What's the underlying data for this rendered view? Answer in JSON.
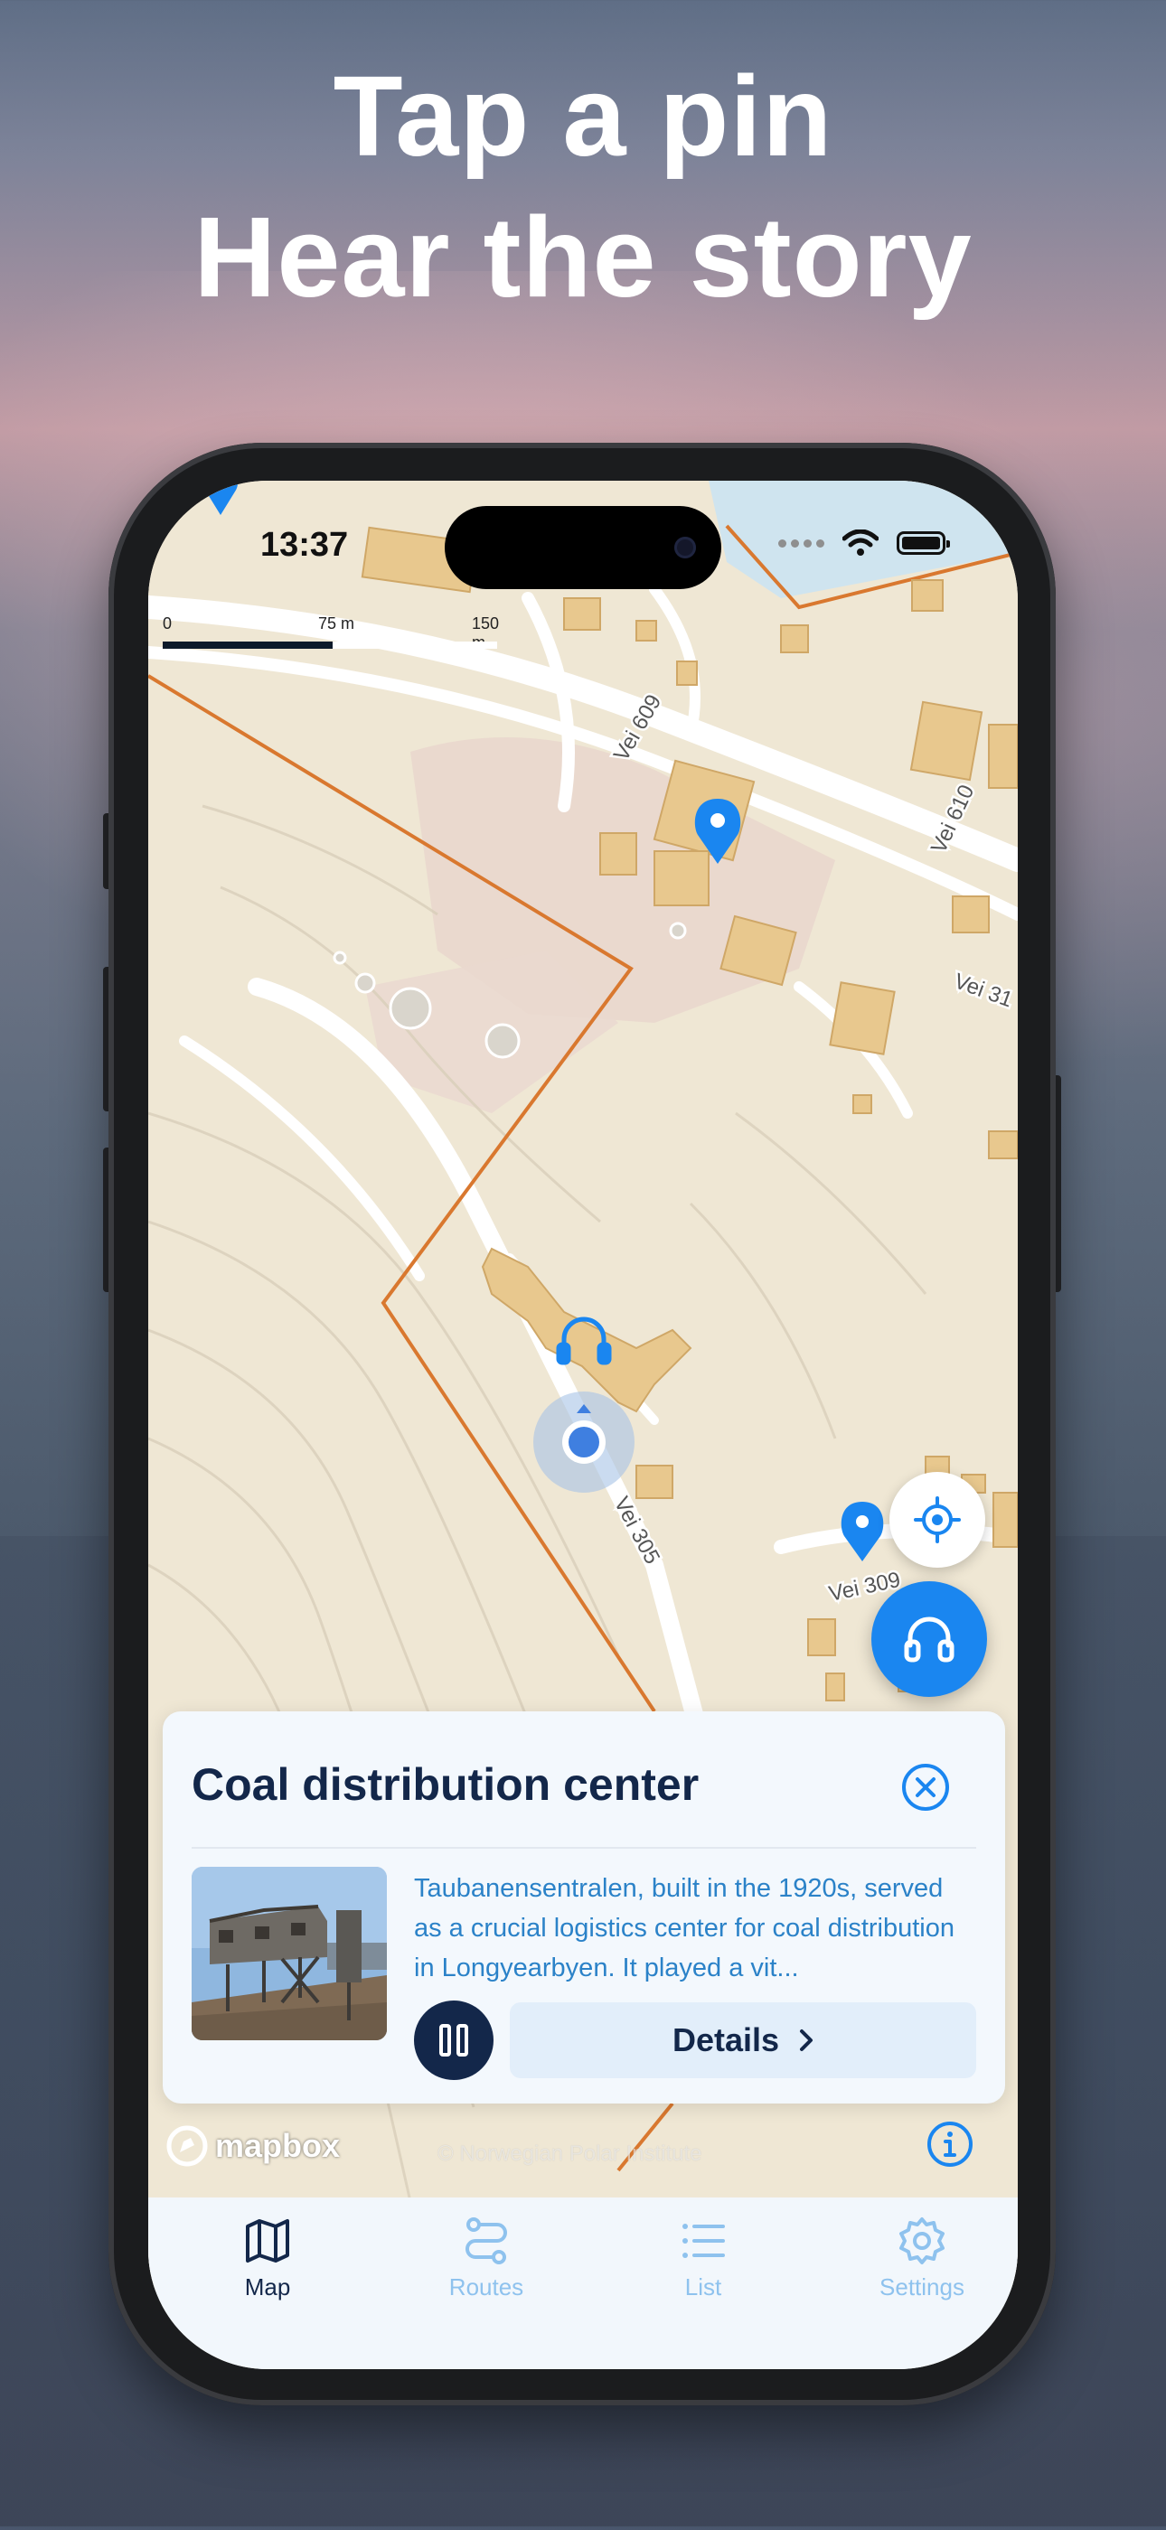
{
  "headline": {
    "line1": "Tap a pin",
    "line2": "Hear the story"
  },
  "status_bar": {
    "time": "13:37"
  },
  "map": {
    "scale": {
      "zero": "0",
      "mid": "75 m",
      "max": "150 m"
    },
    "road_labels": [
      "Vei 609",
      "Vei 610",
      "Vei 31",
      "Vei 305",
      "Vei 309"
    ],
    "attribution": "© Norwegian Polar Institute",
    "logo": "mapbox"
  },
  "card": {
    "title": "Coal distribution center",
    "description": "Taubanensentralen, built in the 1920s, served as a crucial logistics center for coal distribution in Longyearbyen. It played a vit...",
    "details_label": "Details"
  },
  "tabs": [
    {
      "label": "Map",
      "icon": "map-icon",
      "active": true
    },
    {
      "label": "Routes",
      "icon": "routes-icon",
      "active": false
    },
    {
      "label": "List",
      "icon": "list-icon",
      "active": false
    },
    {
      "label": "Settings",
      "icon": "gear-icon",
      "active": false
    }
  ],
  "colors": {
    "accent": "#1a86f0",
    "navy": "#13274a",
    "tab_inactive": "#8ec2ee",
    "boundary": "#d9782f",
    "buildings": "#e8c88e"
  }
}
